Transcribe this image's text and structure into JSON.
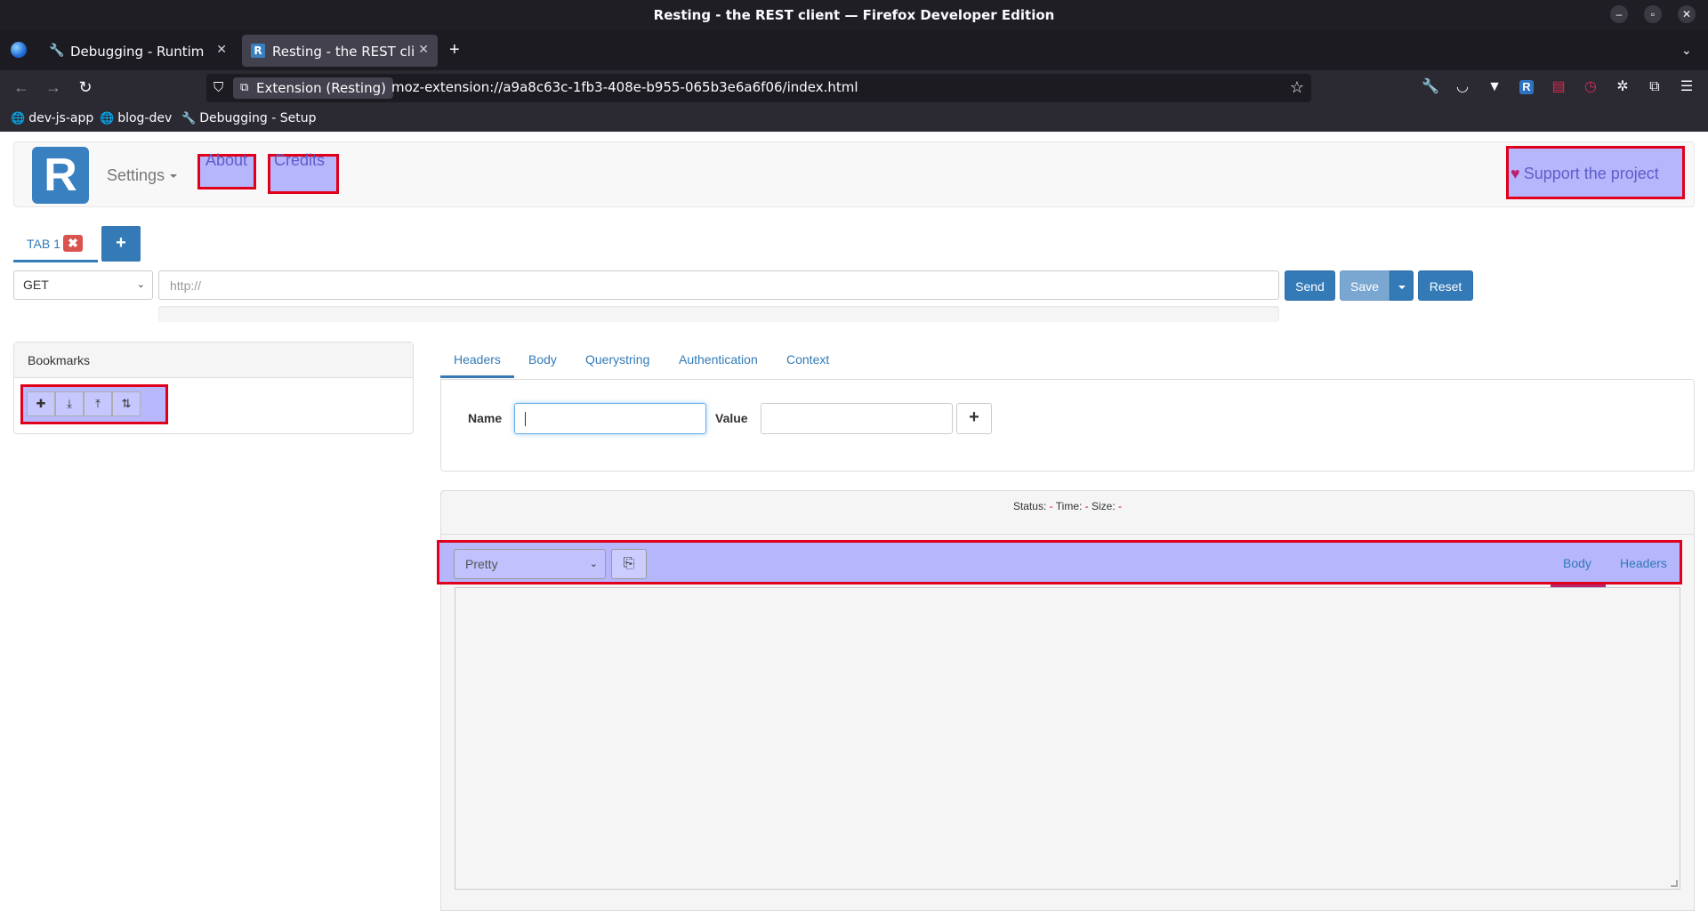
{
  "window": {
    "title": "Resting - the REST client — Firefox Developer Edition",
    "controls": {
      "minimize": "–",
      "restore": "▫",
      "close": "✕"
    }
  },
  "tabs": [
    {
      "label": "Debugging - Runtime / th",
      "icon": "wrench-icon",
      "close": "✕"
    },
    {
      "label": "Resting - the REST client",
      "icon": "resting-favicon",
      "favicon_text": "R",
      "close": "✕"
    }
  ],
  "new_tab_label": "+",
  "navbar": {
    "extension_label": "Extension (Resting)",
    "url": "moz-extension://a9a8c63c-1fb3-408e-b955-065b3e6a6f06/index.html"
  },
  "bookmarks_bar": [
    {
      "label": "dev-js-app",
      "icon": "globe-icon"
    },
    {
      "label": "blog-dev",
      "icon": "globe-icon"
    },
    {
      "label": "Debugging - Setup",
      "icon": "wrench-icon"
    }
  ],
  "app": {
    "logo_letter": "R",
    "nav": {
      "settings": "Settings",
      "about": "About",
      "credits": "Credits",
      "support": "Support the project"
    },
    "request_tab": {
      "label": "TAB 1",
      "close": "✖"
    },
    "add_tab": "+",
    "method": "GET",
    "url_placeholder": "http://",
    "buttons": {
      "send": "Send",
      "save": "Save",
      "reset": "Reset"
    },
    "bookmarks": {
      "title": "Bookmarks",
      "tools": [
        "add-bookmark-icon",
        "import-icon",
        "export-icon",
        "sort-icon"
      ]
    },
    "request_tabs": [
      "Headers",
      "Body",
      "Querystring",
      "Authentication",
      "Context"
    ],
    "header_form": {
      "name_label": "Name",
      "value_label": "Value",
      "add": "+"
    },
    "response": {
      "status_label": "Status:",
      "status_value": "-",
      "time_label": "Time:",
      "time_value": "-",
      "size_label": "Size:",
      "size_value": "-",
      "format": "Pretty",
      "tabs": [
        "Body",
        "Headers"
      ]
    }
  }
}
